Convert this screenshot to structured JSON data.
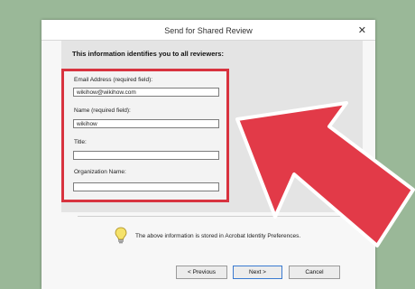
{
  "window": {
    "title": "Send for Shared Review",
    "close_glyph": "✕"
  },
  "form": {
    "heading": "This information identifies you to all reviewers:",
    "fields": [
      {
        "label": "Email Address (required field):",
        "value": "wikihow@wikihow.com"
      },
      {
        "label": "Name (required field):",
        "value": "wikihow"
      },
      {
        "label": "Title:",
        "value": ""
      },
      {
        "label": "Organization Name:",
        "value": ""
      }
    ]
  },
  "info": {
    "text": "The above information is stored in Acrobat Identity Preferences.",
    "icon": "lightbulb-icon"
  },
  "buttons": {
    "previous": "< Previous",
    "next": "Next >",
    "cancel": "Cancel"
  },
  "colors": {
    "highlight": "#d8333f",
    "arrow": "#e23a48",
    "background": "#9ab898"
  }
}
